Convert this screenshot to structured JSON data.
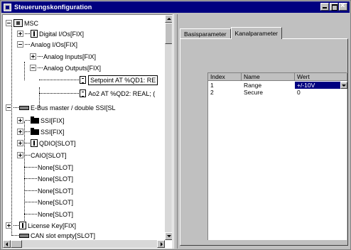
{
  "window": {
    "title": "Steuerungskonfiguration"
  },
  "tree": {
    "root": "MSC",
    "digital_ios": "Digital I/Os[FIX]",
    "analog_ios": "Analog I/Os[FIX]",
    "analog_inputs": "Analog Inputs[FIX]",
    "analog_outputs": "Analog Outputs[FIX]",
    "setpoint": "Setpoint AT %QD1: RE",
    "ao2": "Ao2 AT %QD2: REAL; (",
    "ebus": "E-Bus master / double SSI[SL",
    "ssi1": "SSI[FIX]",
    "ssi2": "SSI[FIX]",
    "qdio": "QDIO[SLOT]",
    "caio": "CAIO[SLOT]",
    "none1": "None[SLOT]",
    "none2": "None[SLOT]",
    "none3": "None[SLOT]",
    "none4": "None[SLOT]",
    "none5": "None[SLOT]",
    "license": "License Key[FIX]",
    "can_slot": "CAN slot empty[SLOT]"
  },
  "tabs": [
    {
      "label": "Basisparameter"
    },
    {
      "label": "Kanalparameter"
    }
  ],
  "grid": {
    "headers": {
      "index": "Index",
      "name": "Name",
      "wert": "Wert"
    },
    "rows": [
      {
        "index": "1",
        "name": "Range",
        "wert": "+/-10V"
      },
      {
        "index": "2",
        "name": "Secure",
        "wert": "0"
      }
    ]
  },
  "colors": {
    "titlebar": "#000080",
    "selection": "#000080",
    "face": "#c0c0c0"
  }
}
